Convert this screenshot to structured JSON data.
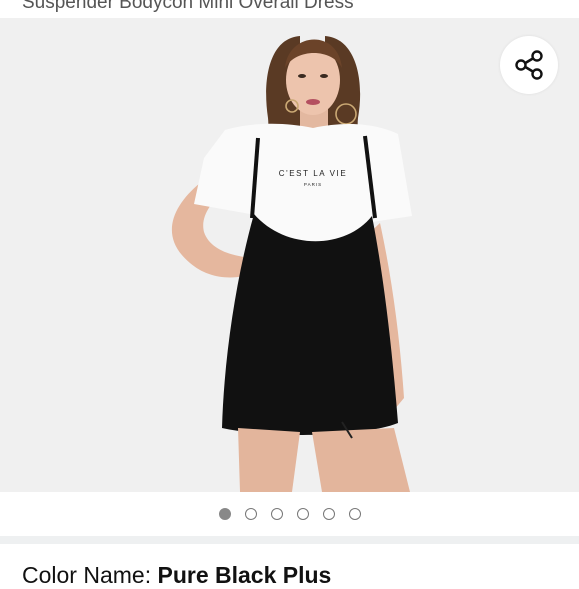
{
  "product": {
    "title": "Suspender Bodycon Mini Overall Dress",
    "shirt_print_line1": "C'EST LA VIE",
    "shirt_print_line2": "PARIS"
  },
  "share": {
    "icon": "share-icon"
  },
  "carousel": {
    "total": 6,
    "active_index": 0
  },
  "color": {
    "label": "Color Name: ",
    "value": "Pure Black Plus"
  },
  "colors": {
    "background": "#f0f0f0",
    "dress": "#111111",
    "tshirt": "#fafafa",
    "active_dot": "#888888"
  }
}
